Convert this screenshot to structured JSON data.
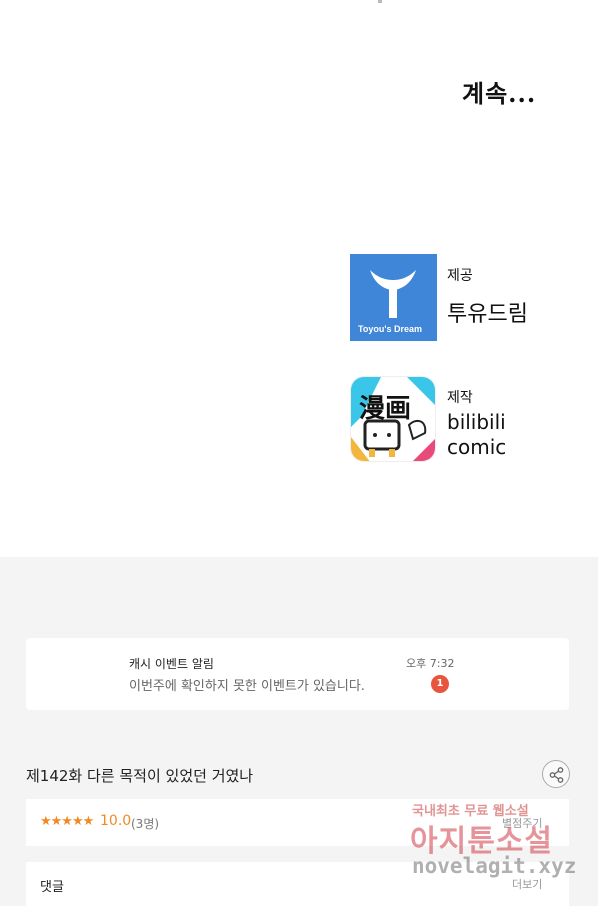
{
  "comic": {
    "to_be_continued": "계속...",
    "provider": {
      "role": "제공",
      "name": "투유드림",
      "logo_caption": "Toyou's Dream"
    },
    "producer": {
      "role": "제작",
      "name_line1": "bilibili",
      "name_line2": "comic",
      "logo_text": "漫画"
    }
  },
  "notice": {
    "title": "캐시 이벤트 알림",
    "message": "이번주에 확인하지 못한 이벤트가 있습니다.",
    "time": "오후 7:32",
    "badge": "1"
  },
  "episode": {
    "title": "제142화 다른 목적이 있었던 거였나",
    "share_icon": "share-icon"
  },
  "rating": {
    "stars": "★★★★★",
    "score": "10.0",
    "count": "(3명)",
    "rate_label": "별점주기"
  },
  "comments": {
    "label": "댓글",
    "more_label": "더보기"
  },
  "watermark": {
    "line1": "국내최초 무료 웹소설",
    "line2": "아지툰소설",
    "line3": "novelagit.xyz"
  },
  "colors": {
    "toyou_blue": "#3f86d8",
    "star_orange": "#f08a24",
    "badge_red": "#e8553e",
    "page_gray": "#f4f4f4"
  }
}
